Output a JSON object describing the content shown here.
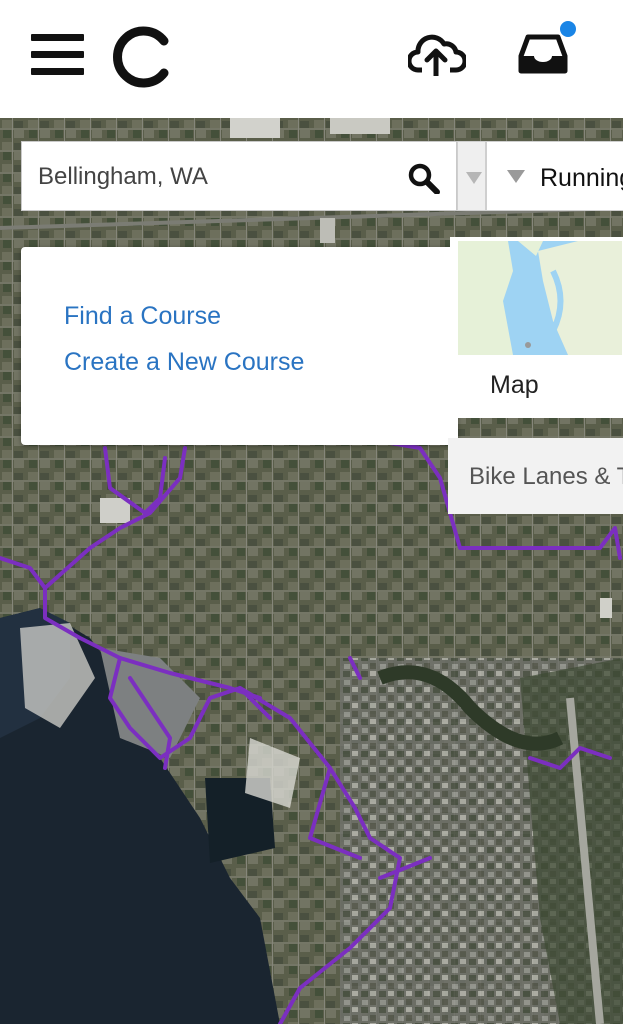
{
  "header": {
    "menu_icon": "hamburger-menu-icon",
    "logo_icon": "mapmyrun-c-logo-icon",
    "upload_icon": "cloud-upload-icon",
    "inbox_icon": "inbox-tray-icon",
    "notification_color": "#1a85e6"
  },
  "search": {
    "value": "Bellingham, WA",
    "icon": "search-icon"
  },
  "activity_filter": {
    "label": "Running"
  },
  "course_menu": {
    "items": [
      {
        "label": "Find a Course"
      },
      {
        "label": "Create a New Course"
      }
    ]
  },
  "map_controls": {
    "map_type_label": "Map",
    "bike_lanes_label": "Bike Lanes & Trails"
  },
  "colors": {
    "link": "#2a74c2",
    "bike_route": "#7b2fc0"
  }
}
